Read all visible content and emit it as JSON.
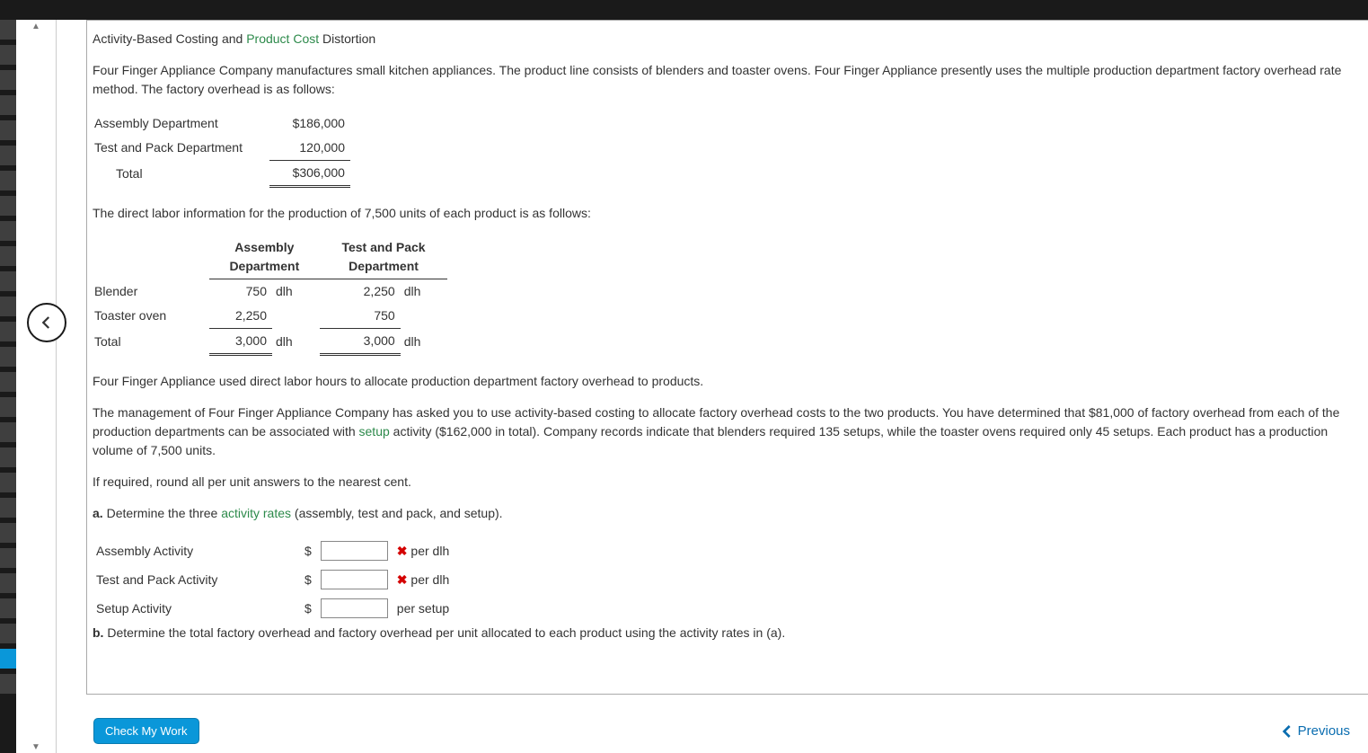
{
  "title_parts": {
    "p1": "Activity-Based Costing and ",
    "link1": "Product Cost",
    "p2": " Distortion"
  },
  "intro": "Four Finger Appliance Company manufactures small kitchen appliances. The product line consists of blenders and toaster ovens. Four Finger Appliance presently uses the multiple production department factory overhead rate method. The factory overhead is as follows:",
  "oh_table": {
    "r1": {
      "label": "Assembly Department",
      "val": "$186,000"
    },
    "r2": {
      "label": "Test and Pack Department",
      "val": "120,000"
    },
    "r3": {
      "label": "Total",
      "val": "$306,000"
    }
  },
  "dl_intro": "The direct labor information for the production of 7,500 units of each product is as follows:",
  "dl_table": {
    "h1": "Assembly Department",
    "h2": "Test and Pack Department",
    "r1": {
      "label": "Blender",
      "c1": "750",
      "u1": "dlh",
      "c2": "2,250",
      "u2": "dlh"
    },
    "r2": {
      "label": "Toaster oven",
      "c1": "2,250",
      "u1": "",
      "c2": "750",
      "u2": ""
    },
    "r3": {
      "label": "Total",
      "c1": "3,000",
      "u1": "dlh",
      "c2": "3,000",
      "u2": "dlh"
    }
  },
  "p3": "Four Finger Appliance used direct labor hours to allocate production department factory overhead to products.",
  "p4a": "The management of Four Finger Appliance Company has asked you to use activity-based costing to allocate factory overhead costs to the two products. You have determined that $81,000 of factory overhead from each of the production departments can be associated with ",
  "p4link": "setup",
  "p4b": " activity ($162,000 in total). Company records indicate that blenders required 135 setups, while the toaster ovens required only 45 setups. Each product has a production volume of 7,500 units.",
  "p5": "If required, round all per unit answers to the nearest cent.",
  "qa": {
    "label": "a.",
    "text_a": " Determine the three ",
    "link": "activity rates",
    "text_b": " (assembly, test and pack, and setup)."
  },
  "answers": {
    "r1": {
      "label": "Assembly Activity",
      "unit": "per dlh",
      "wrong": true
    },
    "r2": {
      "label": "Test and Pack Activity",
      "unit": "per dlh",
      "wrong": true
    },
    "r3": {
      "label": "Setup Activity",
      "unit": "per setup",
      "wrong": false
    }
  },
  "qb": {
    "label": "b.",
    "text": " Determine the total factory overhead and factory overhead per unit allocated to each product using the activity rates in (a)."
  },
  "buttons": {
    "check": "Check My Work",
    "prev": "Previous"
  },
  "icons": {
    "wrong_mark": "✖"
  }
}
